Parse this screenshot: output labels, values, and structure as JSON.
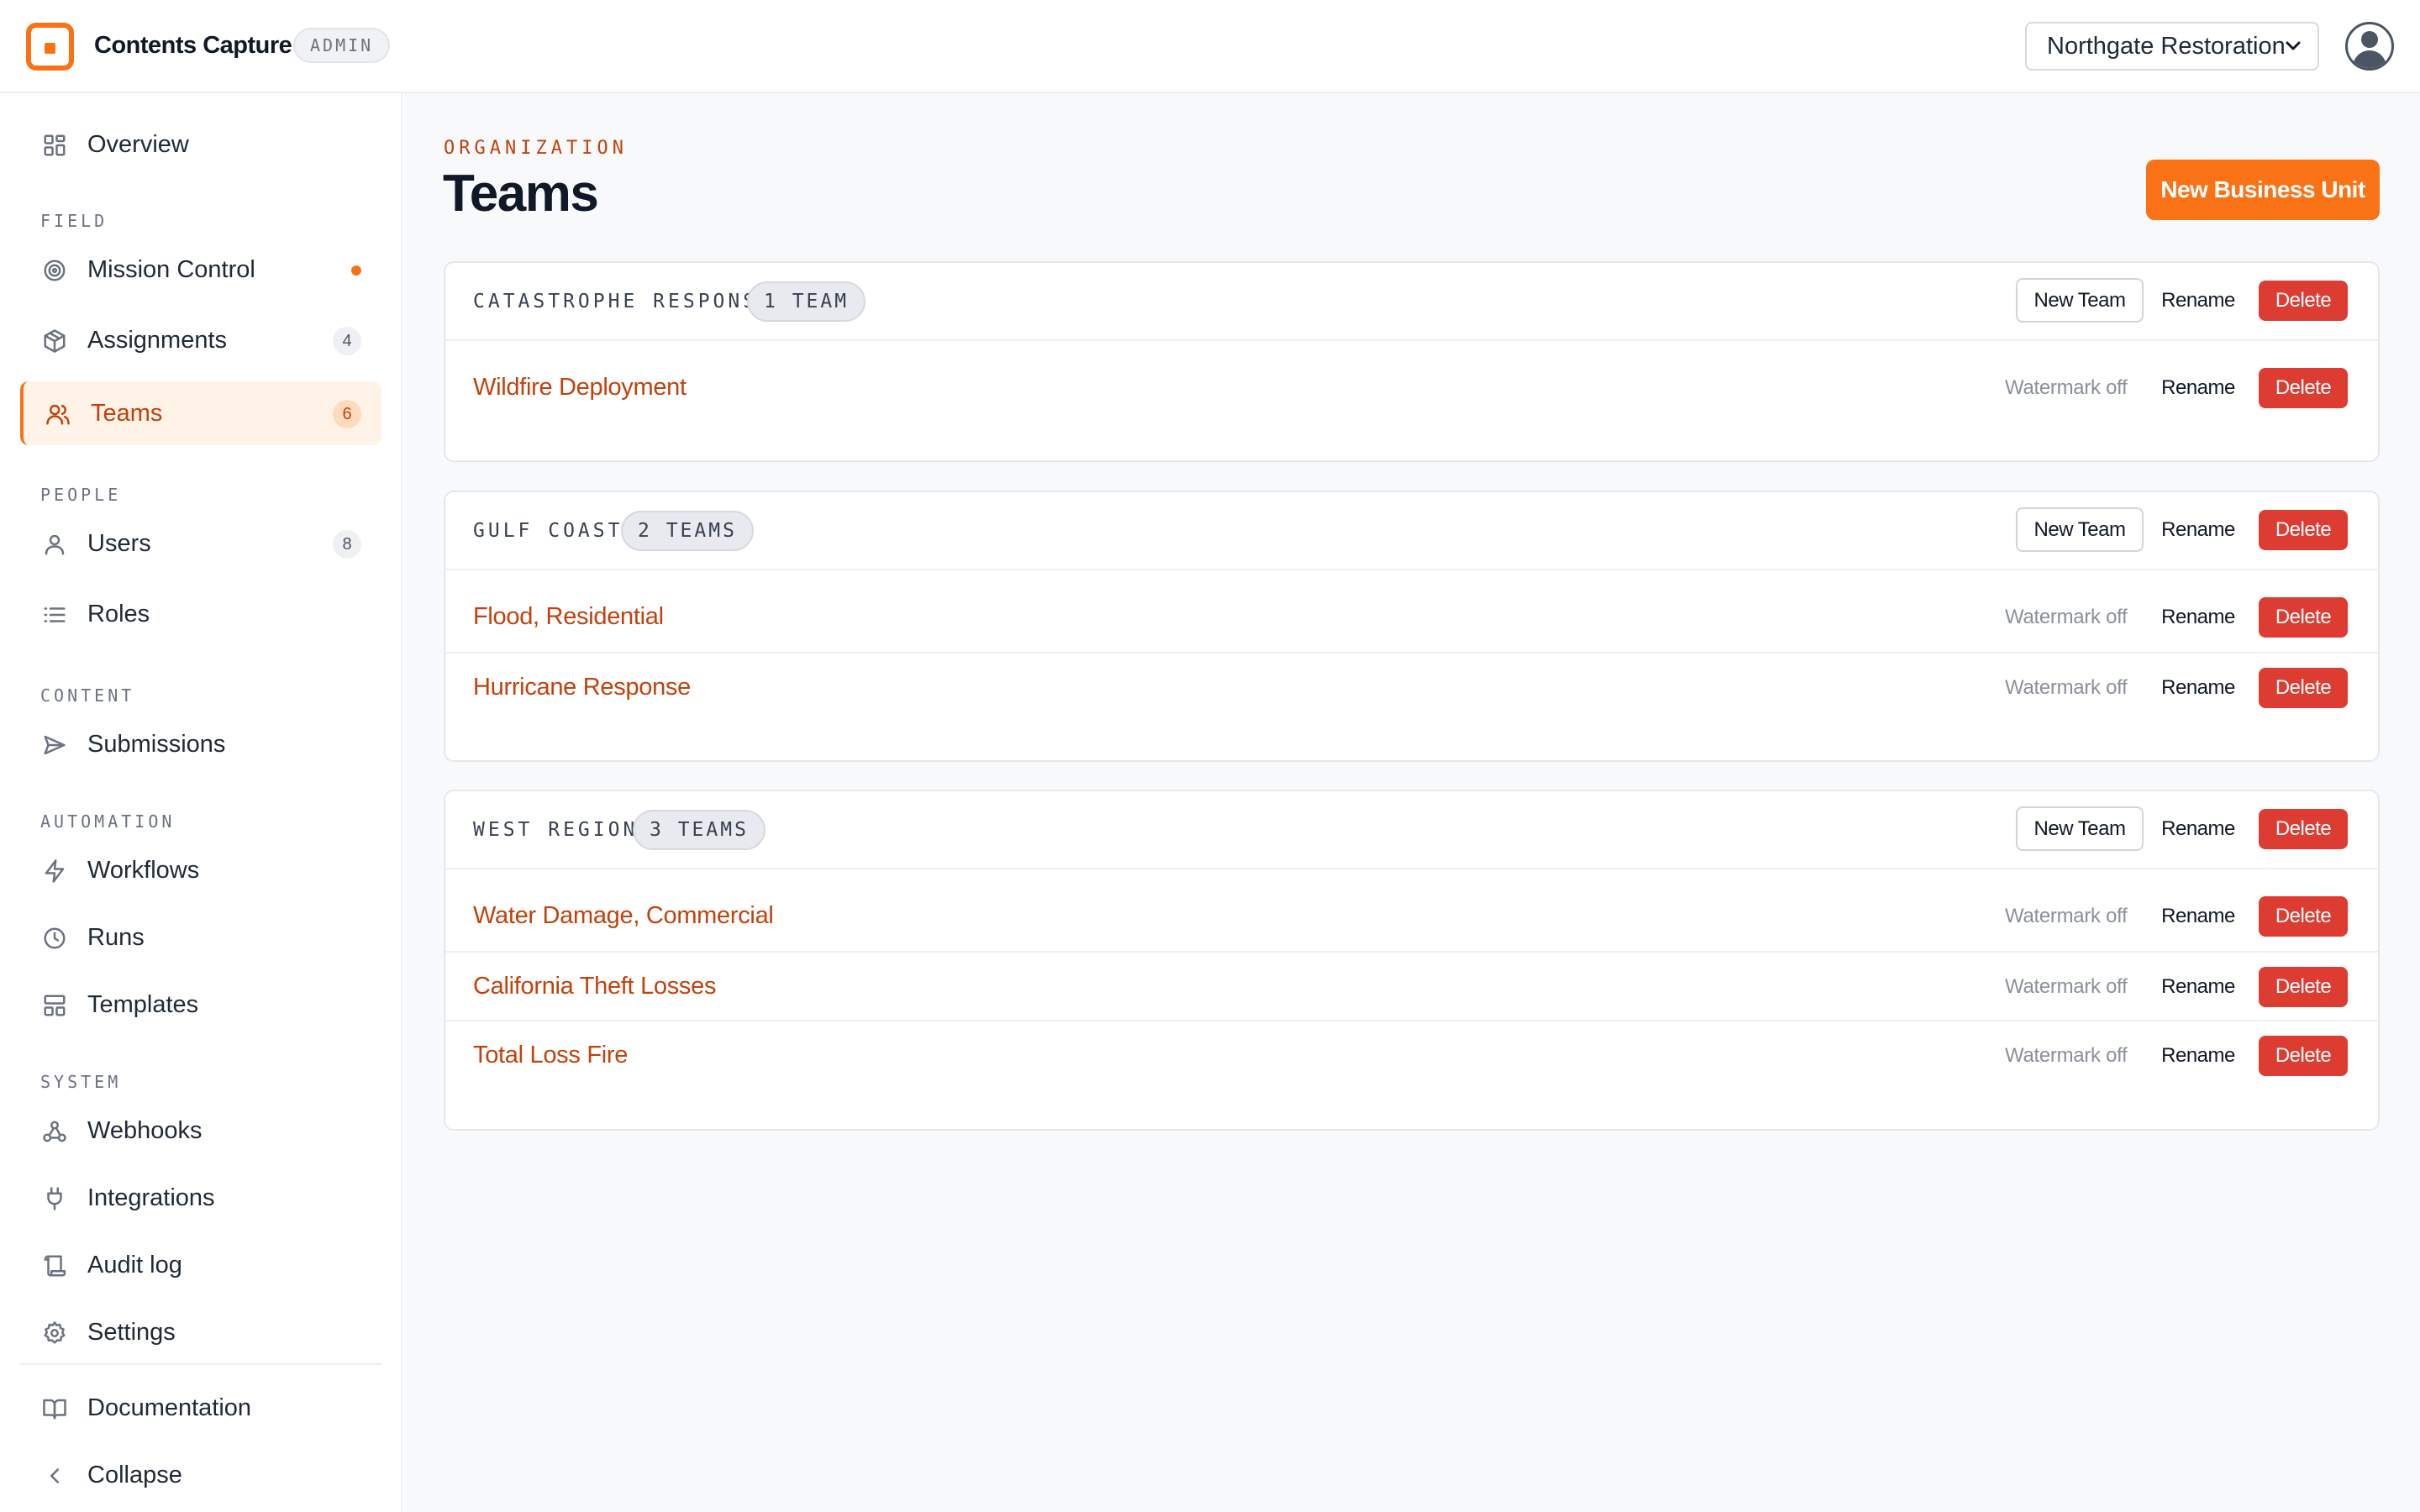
{
  "app": {
    "name": "Contents Capture",
    "badge": "ADMIN",
    "org_selector": "Northgate Restoration"
  },
  "sidebar": {
    "overview": "Overview",
    "sections": {
      "field": "FIELD",
      "people": "PEOPLE",
      "content": "CONTENT",
      "automation": "AUTOMATION",
      "system": "SYSTEM"
    },
    "items": {
      "mission_control": "Mission Control",
      "assignments": "Assignments",
      "assignments_count": "4",
      "teams": "Teams",
      "teams_count": "6",
      "users": "Users",
      "users_count": "8",
      "roles": "Roles",
      "submissions": "Submissions",
      "workflows": "Workflows",
      "runs": "Runs",
      "templates": "Templates",
      "webhooks": "Webhooks",
      "integrations": "Integrations",
      "audit_log": "Audit log",
      "settings": "Settings",
      "documentation": "Documentation",
      "collapse": "Collapse"
    }
  },
  "page": {
    "eyebrow": "ORGANIZATION",
    "title": "Teams",
    "new_business_unit": "New Business Unit"
  },
  "actions": {
    "new_team": "New Team",
    "rename": "Rename",
    "delete": "Delete",
    "watermark_off": "Watermark off"
  },
  "business_units": [
    {
      "name": "CATASTROPHE RESPONSE",
      "count": "1 TEAM",
      "teams": [
        "Wildfire Deployment"
      ]
    },
    {
      "name": "GULF COAST",
      "count": "2 TEAMS",
      "teams": [
        "Flood, Residential",
        "Hurricane Response"
      ]
    },
    {
      "name": "WEST REGION",
      "count": "3 TEAMS",
      "teams": [
        "Water Damage, Commercial",
        "California Theft Losses",
        "Total Loss Fire"
      ]
    }
  ],
  "colors": {
    "accent": "#f97316",
    "accent_text": "#c2410c",
    "danger": "#dc3c32"
  }
}
